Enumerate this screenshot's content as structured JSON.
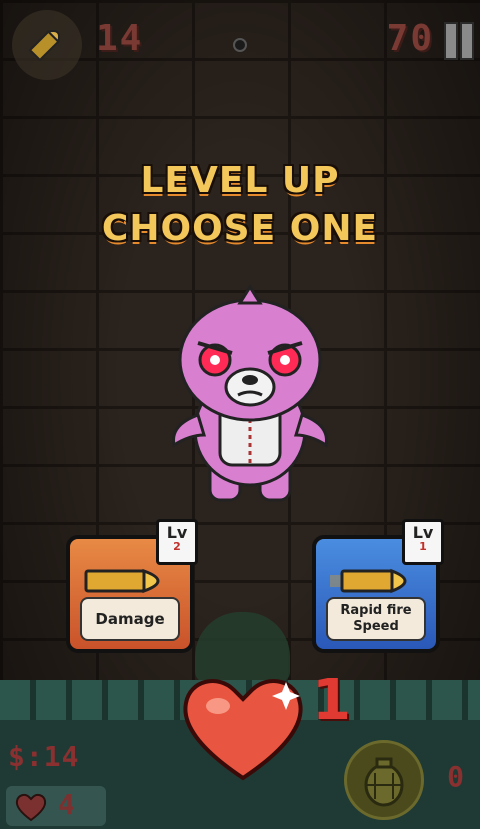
{
  "hud": {
    "ammo_count": "14",
    "score": "70",
    "ammo_icon": "bullet-icon",
    "pause_icon": "pause-icon"
  },
  "title": {
    "line1": "LEVEL UP",
    "line2": "CHOOSE ONE"
  },
  "cards": [
    {
      "label": "Damage",
      "lv_label": "Lv",
      "lv_value": "2",
      "color": "#e06a35",
      "icon": "bullet-icon"
    },
    {
      "label": "Rapid fire Speed",
      "lv_label": "Lv",
      "lv_value": "1",
      "color": "#3a6fd0",
      "icon": "bullet-icon"
    }
  ],
  "bottom": {
    "money": "$:14",
    "lives": "4",
    "heart_pickup_count": "1",
    "grenade_count": "0",
    "grenade_icon": "grenade-icon"
  },
  "colors": {
    "title_yellow": "#f4c75a",
    "hud_red": "#7a3a34",
    "monster_pink": "#d97fd0"
  }
}
